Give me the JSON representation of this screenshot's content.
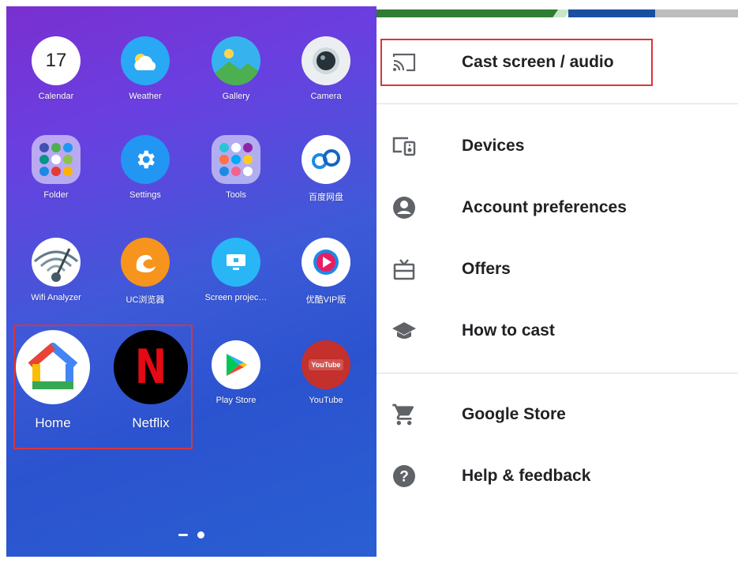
{
  "home_screen": {
    "apps": [
      {
        "label": "Calendar",
        "icon": "calendar-icon",
        "badge": "17"
      },
      {
        "label": "Weather",
        "icon": "weather-icon"
      },
      {
        "label": "Gallery",
        "icon": "gallery-icon"
      },
      {
        "label": "Camera",
        "icon": "camera-icon"
      },
      {
        "label": "Folder",
        "icon": "folder-icon"
      },
      {
        "label": "Settings",
        "icon": "gear-icon"
      },
      {
        "label": "Tools",
        "icon": "folder-icon"
      },
      {
        "label": "百度网盘",
        "icon": "baidu-netdisk-icon"
      },
      {
        "label": "Wifi Analyzer",
        "icon": "wifi-analyzer-icon"
      },
      {
        "label": "UC浏览器",
        "icon": "uc-browser-icon"
      },
      {
        "label": "Screen projec…",
        "icon": "screen-projection-icon"
      },
      {
        "label": "优酷VIP版",
        "icon": "youku-icon"
      },
      {
        "label": "Home",
        "icon": "google-home-icon"
      },
      {
        "label": "Netflix",
        "icon": "netflix-icon",
        "glyph": "N"
      },
      {
        "label": "Play Store",
        "icon": "play-store-icon"
      },
      {
        "label": "YouTube",
        "icon": "youtube-icon",
        "glyph": "YouTube"
      }
    ],
    "page_indicator": {
      "pages": 2,
      "current": 2
    }
  },
  "cast_menu": {
    "items": [
      {
        "label": "Cast screen / audio",
        "icon": "cast-icon"
      },
      {
        "label": "Devices",
        "icon": "devices-icon"
      },
      {
        "label": "Account preferences",
        "icon": "account-icon"
      },
      {
        "label": "Offers",
        "icon": "offers-icon"
      },
      {
        "label": "How to cast",
        "icon": "school-icon"
      },
      {
        "label": "Google Store",
        "icon": "shopping-cart-icon"
      },
      {
        "label": "Help & feedback",
        "icon": "help-icon"
      }
    ]
  },
  "colors": {
    "highlight_border": "#d8353b",
    "menu_text": "#202124",
    "menu_icon": "#5f6368",
    "wallpaper_top": "#7a2fd0",
    "wallpaper_bottom": "#2a5fd2"
  }
}
